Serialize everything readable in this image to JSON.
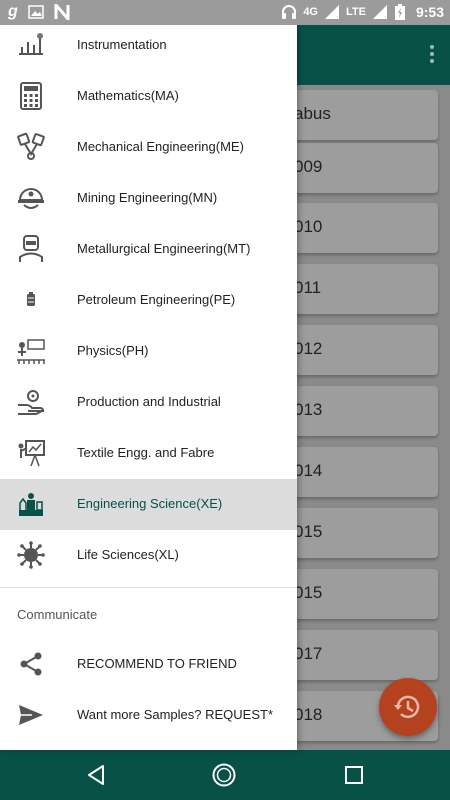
{
  "status_bar": {
    "network_label": "4G",
    "lte_label": "LTE",
    "time": "9:53"
  },
  "background": {
    "cards": [
      "abus",
      "009",
      "010",
      "011",
      "012",
      "013",
      "014",
      "015",
      "015",
      "017",
      "018"
    ]
  },
  "drawer": {
    "items": [
      {
        "label": "Instrumentation",
        "icon": "instrumentation-icon"
      },
      {
        "label": "Mathematics(MA)",
        "icon": "calculator-icon"
      },
      {
        "label": "Mechanical Engineering(ME)",
        "icon": "pistons-icon"
      },
      {
        "label": "Mining Engineering(MN)",
        "icon": "mining-helmet-icon"
      },
      {
        "label": "Metallurgical Engineering(MT)",
        "icon": "welder-icon"
      },
      {
        "label": "Petroleum Engineering(PE)",
        "icon": "oil-barrel-icon"
      },
      {
        "label": "Physics(PH)",
        "icon": "physics-icon"
      },
      {
        "label": "Production and Industrial",
        "icon": "hand-gear-icon"
      },
      {
        "label": "Textile Engg. and Fabre",
        "icon": "presentation-icon"
      },
      {
        "label": "Engineering Science(XE)",
        "icon": "lab-science-icon",
        "selected": true
      },
      {
        "label": "Life Sciences(XL)",
        "icon": "virus-icon"
      }
    ],
    "communicate_header": "Communicate",
    "communicate_items": [
      {
        "label": "RECOMMEND TO FRIEND",
        "icon": "share-icon"
      },
      {
        "label": "Want more Samples? REQUEST*",
        "icon": "send-icon"
      }
    ]
  },
  "colors": {
    "primary": "#075146",
    "accent": "#b5421e",
    "selected_row": "#dcdcdc"
  }
}
